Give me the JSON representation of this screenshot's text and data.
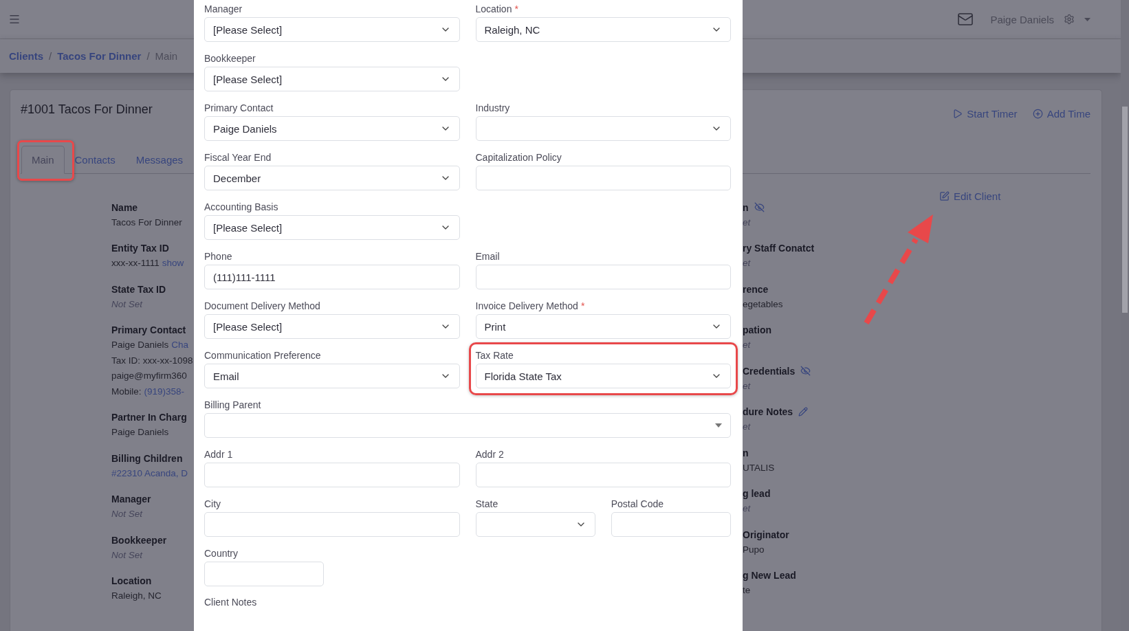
{
  "header": {
    "user_name": "Paige Daniels"
  },
  "breadcrumb": [
    {
      "label": "Clients",
      "current": false
    },
    {
      "separator": "/"
    },
    {
      "label": "Tacos For Dinner",
      "current": false
    },
    {
      "separator": "/"
    },
    {
      "label": "Main",
      "current": true
    }
  ],
  "client": {
    "title": "#1001 Tacos For Dinner",
    "actions": [
      {
        "label": "Start Timer",
        "kind": "timer"
      },
      {
        "label": "Add Time",
        "kind": "add"
      }
    ],
    "tabs": [
      {
        "label": "Main",
        "selected": true,
        "highlighted": true
      },
      {
        "label": "Contacts",
        "selected": false,
        "highlighted": false
      },
      {
        "label": "Messages",
        "selected": false,
        "highlighted": false
      }
    ],
    "edit_link": "Edit Client",
    "details_left": [
      {
        "label": "Name",
        "lines": [
          [
            {
              "text": "Tacos For Dinner",
              "kind": "plain"
            }
          ]
        ]
      },
      {
        "label": "Entity Tax ID",
        "lines": [
          [
            {
              "text": "xxx-xx-1111",
              "kind": "plain"
            },
            {
              "text": "show",
              "kind": "link"
            }
          ]
        ]
      },
      {
        "label": "State Tax ID",
        "lines": [
          [
            {
              "text": "Not Set",
              "kind": "muted"
            }
          ]
        ]
      },
      {
        "label": "Primary Contact",
        "lines": [
          [
            {
              "text": "Paige Daniels",
              "kind": "plain"
            },
            {
              "text": "Cha",
              "kind": "link"
            }
          ],
          [
            {
              "text": "Tax ID: xxx-xx-1098",
              "kind": "plain"
            }
          ],
          [
            {
              "text": "paige@myfirm360",
              "kind": "plain"
            }
          ],
          [
            {
              "text": "Mobile:",
              "kind": "plain"
            },
            {
              "text": "(919)358-",
              "kind": "link"
            }
          ]
        ]
      },
      {
        "label": "Partner In Charg",
        "lines": [
          [
            {
              "text": "Paige Daniels",
              "kind": "plain"
            }
          ]
        ]
      },
      {
        "label": "Billing Children",
        "lines": [
          [
            {
              "text": "#22310 Acanda, D",
              "kind": "link"
            }
          ]
        ]
      },
      {
        "label": "Manager",
        "lines": [
          [
            {
              "text": "Not Set",
              "kind": "muted"
            }
          ]
        ]
      },
      {
        "label": "Bookkeeper",
        "lines": [
          [
            {
              "text": "Not Set",
              "kind": "muted"
            }
          ]
        ]
      },
      {
        "label": "Location",
        "lines": [
          [
            {
              "text": "Raleigh, NC",
              "kind": "plain"
            }
          ]
        ]
      }
    ],
    "details_right": [
      {
        "label": "n",
        "kind": "private",
        "lines": [
          [
            {
              "text": "et",
              "kind": "muted"
            }
          ]
        ]
      },
      {
        "label": "ry Staff Conatct",
        "kind": "plain",
        "lines": [
          [
            {
              "text": "et",
              "kind": "muted"
            }
          ]
        ]
      },
      {
        "label": "rence",
        "kind": "plain",
        "lines": [
          [
            {
              "text": "egetables",
              "kind": "plain"
            }
          ]
        ]
      },
      {
        "label": "pation",
        "kind": "plain",
        "lines": [
          [
            {
              "text": "et",
              "kind": "muted"
            }
          ]
        ]
      },
      {
        "label": "Credentials",
        "kind": "private",
        "lines": [
          [
            {
              "text": "et",
              "kind": "muted"
            }
          ]
        ]
      },
      {
        "label": "dure Notes",
        "kind": "editable",
        "lines": [
          [
            {
              "text": "et",
              "kind": "muted"
            }
          ]
        ]
      },
      {
        "label": "n",
        "kind": "plain",
        "lines": [
          [
            {
              "text": "UTALIS",
              "kind": "plain"
            }
          ]
        ]
      },
      {
        "label": "g lead",
        "kind": "plain",
        "lines": [
          [
            {
              "text": "et",
              "kind": "muted"
            }
          ]
        ]
      },
      {
        "label": "Originator",
        "kind": "plain",
        "lines": [
          [
            {
              "text": "Pupo",
              "kind": "plain"
            }
          ]
        ]
      },
      {
        "label": "g New Lead",
        "kind": "plain",
        "lines": [
          [
            {
              "text": "te",
              "kind": "plain"
            }
          ]
        ]
      }
    ]
  },
  "modal": {
    "rows": [
      {
        "fields": [
          {
            "label": "Manager",
            "kind": "select",
            "value": "[Please Select]",
            "required": false,
            "highlighted": false
          },
          {
            "label": "Location",
            "kind": "select",
            "value": "Raleigh, NC",
            "required": true,
            "highlighted": false
          }
        ]
      },
      {
        "fields": [
          {
            "label": "Bookkeeper",
            "kind": "select",
            "value": "[Please Select]",
            "required": false,
            "highlighted": false
          }
        ]
      },
      {
        "fields": [
          {
            "label": "Primary Contact",
            "kind": "select",
            "value": "Paige Daniels",
            "required": false,
            "highlighted": false
          },
          {
            "label": "Industry",
            "kind": "select",
            "required": false,
            "highlighted": false
          }
        ]
      },
      {
        "fields": [
          {
            "label": "Fiscal Year End",
            "kind": "select",
            "value": "December",
            "required": false,
            "highlighted": false
          },
          {
            "label": "Capitalization Policy",
            "kind": "text",
            "required": false,
            "highlighted": false
          }
        ]
      },
      {
        "fields": [
          {
            "label": "Accounting Basis",
            "kind": "select",
            "value": "[Please Select]",
            "required": false,
            "highlighted": false
          }
        ]
      },
      {
        "fields": [
          {
            "label": "Phone",
            "kind": "text",
            "value": "(111)111-1111",
            "required": false,
            "highlighted": false
          },
          {
            "label": "Email",
            "kind": "text",
            "required": false,
            "highlighted": false
          }
        ]
      },
      {
        "fields": [
          {
            "label": "Document Delivery Method",
            "kind": "select",
            "value": "[Please Select]",
            "required": false,
            "highlighted": false
          },
          {
            "label": "Invoice Delivery Method",
            "kind": "select",
            "value": "Print",
            "required": true,
            "highlighted": false
          }
        ]
      },
      {
        "fields": [
          {
            "label": "Communication Preference",
            "kind": "select",
            "value": "Email",
            "required": false,
            "highlighted": false
          },
          {
            "label": "Tax Rate",
            "kind": "select",
            "value": "Florida State Tax",
            "required": false,
            "highlighted": true
          }
        ]
      },
      {
        "fields": [
          {
            "label": "Billing Parent",
            "kind": "combo",
            "required": false,
            "highlighted": false
          }
        ]
      },
      {
        "fields": [
          {
            "label": "Addr 1",
            "kind": "text",
            "required": false,
            "highlighted": false
          },
          {
            "label": "Addr 2",
            "kind": "text",
            "required": false,
            "highlighted": false
          }
        ]
      },
      {
        "fields": [
          {
            "label": "City",
            "kind": "text",
            "required": false,
            "highlighted": false
          },
          {
            "label": "State",
            "kind": "select",
            "required": false,
            "highlighted": false
          },
          {
            "label": "Postal Code",
            "kind": "text",
            "required": false,
            "highlighted": false
          }
        ]
      },
      {
        "fields": [
          {
            "label": "Country",
            "kind": "text",
            "required": false,
            "highlighted": false
          }
        ]
      }
    ],
    "trailing_label": "Client Notes",
    "required_mark": "*"
  }
}
